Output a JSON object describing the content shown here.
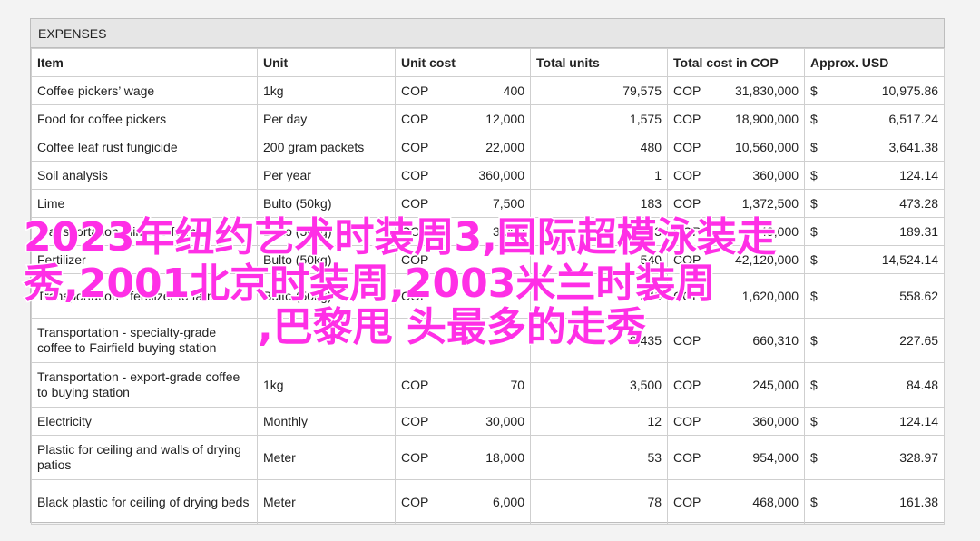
{
  "section_title": "EXPENSES",
  "headers": {
    "item": "Item",
    "unit": "Unit",
    "unit_cost": "Unit cost",
    "total_units": "Total units",
    "total_cost": "Total cost in COP",
    "usd": "Approx. USD"
  },
  "rows": [
    {
      "item": "Coffee pickers’ wage",
      "unit": "1kg",
      "cur": "COP",
      "unit_cost": "400",
      "total_units": "79,575",
      "tcur": "COP",
      "total_cost": "31,830,000",
      "usym": "$",
      "usd": "10,975.86"
    },
    {
      "item": "Food for coffee pickers",
      "unit": "Per day",
      "cur": "COP",
      "unit_cost": "12,000",
      "total_units": "1,575",
      "tcur": "COP",
      "total_cost": "18,900,000",
      "usym": "$",
      "usd": "6,517.24"
    },
    {
      "item": "Coffee leaf rust fungicide",
      "unit": "200 gram packets",
      "cur": "COP",
      "unit_cost": "22,000",
      "total_units": "480",
      "tcur": "COP",
      "total_cost": "10,560,000",
      "usym": "$",
      "usd": "3,641.38"
    },
    {
      "item": "Soil analysis",
      "unit": "Per year",
      "cur": "COP",
      "unit_cost": "360,000",
      "total_units": "1",
      "tcur": "COP",
      "total_cost": "360,000",
      "usym": "$",
      "usd": "124.14"
    },
    {
      "item": "Lime",
      "unit": "Bulto (50kg)",
      "cur": "COP",
      "unit_cost": "7,500",
      "total_units": "183",
      "tcur": "COP",
      "total_cost": "1,372,500",
      "usym": "$",
      "usd": "473.28"
    },
    {
      "item": "Transportation - lime to farm",
      "unit": "Bulto (50kg)",
      "cur": "COP",
      "unit_cost": "3,000",
      "total_units": "183",
      "tcur": "COP",
      "total_cost": "549,000",
      "usym": "$",
      "usd": "189.31"
    },
    {
      "item": "Fertilizer",
      "unit": "Bulto (50kg)",
      "cur": "COP",
      "unit_cost": "",
      "total_units": "540",
      "tcur": "COP",
      "total_cost": "42,120,000",
      "usym": "$",
      "usd": "14,524.14"
    },
    {
      "item": "Transportation - fertilizer to farm",
      "unit": "Bulto (50kg)",
      "cur": "COP",
      "unit_cost": "",
      "total_units": "540",
      "tcur": "COP",
      "total_cost": "1,620,000",
      "usym": "$",
      "usd": "558.62"
    },
    {
      "item": "Transportation - specialty-grade coffee to Fairfield buying station",
      "unit": "",
      "cur": "",
      "unit_cost": "",
      "total_units": "9,435",
      "tcur": "COP",
      "total_cost": "660,310",
      "usym": "$",
      "usd": "227.65"
    },
    {
      "item": "Transportation - export-grade coffee to buying station",
      "unit": "1kg",
      "cur": "COP",
      "unit_cost": "70",
      "total_units": "3,500",
      "tcur": "COP",
      "total_cost": "245,000",
      "usym": "$",
      "usd": "84.48"
    },
    {
      "item": "Electricity",
      "unit": "Monthly",
      "cur": "COP",
      "unit_cost": "30,000",
      "total_units": "12",
      "tcur": "COP",
      "total_cost": "360,000",
      "usym": "$",
      "usd": "124.14"
    },
    {
      "item": "Plastic for ceiling and walls of drying patios",
      "unit": "Meter",
      "cur": "COP",
      "unit_cost": "18,000",
      "total_units": "53",
      "tcur": "COP",
      "total_cost": "954,000",
      "usym": "$",
      "usd": "328.97"
    },
    {
      "item": "Black plastic for ceiling of drying beds",
      "unit": "Meter",
      "cur": "COP",
      "unit_cost": "6,000",
      "total_units": "78",
      "tcur": "COP",
      "total_cost": "468,000",
      "usym": "$",
      "usd": "161.38"
    }
  ],
  "overlay_caption": {
    "line1": "2023年纽约艺术时装周3,国际超模泳装走",
    "line2": "秀,2001北京时装周,2003米兰时装周",
    "line3": ",巴黎甩 头最多的走秀",
    "color": "#ff2fe6"
  }
}
